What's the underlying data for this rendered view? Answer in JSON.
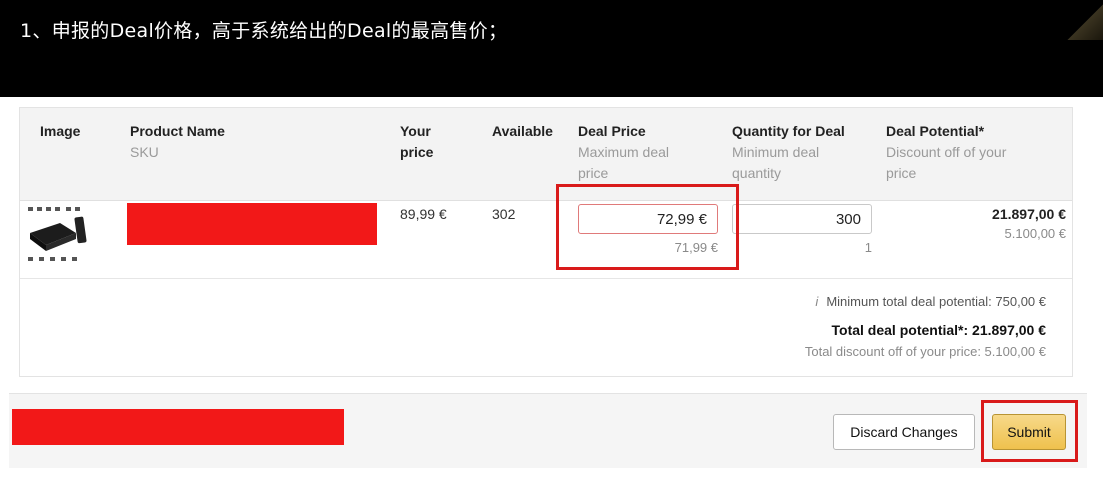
{
  "caption": "1、申报的Deal价格，高于系统给出的Deal的最高售价；",
  "table": {
    "headers": {
      "image": "Image",
      "product_name": "Product Name",
      "product_sub": "SKU",
      "your_price_1": "Your",
      "your_price_2": "price",
      "available": "Available",
      "deal_price": "Deal Price",
      "deal_price_sub_1": "Maximum deal",
      "deal_price_sub_2": "price",
      "quantity": "Quantity for Deal",
      "quantity_sub_1": "Minimum deal",
      "quantity_sub_2": "quantity",
      "potential": "Deal Potential*",
      "potential_sub_1": "Discount off of your",
      "potential_sub_2": "price"
    },
    "row": {
      "your_price": "89,99 €",
      "available": "302",
      "deal_price_value": "72,99 €",
      "deal_price_max": "71,99 €",
      "quantity_value": "300",
      "quantity_min": "1",
      "potential_total": "21.897,00 €",
      "potential_discount": "5.100,00 €"
    }
  },
  "summary": {
    "info_icon": "i",
    "minimum": "Minimum total deal potential: 750,00 €",
    "total": "Total deal potential*: 21.897,00 €",
    "discount": "Total discount off of your price: 5.100,00 €"
  },
  "buttons": {
    "discard": "Discard Changes",
    "submit": "Submit"
  },
  "colors": {
    "highlight": "#d91a1a",
    "redaction": "#f21818",
    "submit_button": "#efc14d"
  },
  "icons": [
    "info-icon",
    "product-thumbnail"
  ]
}
